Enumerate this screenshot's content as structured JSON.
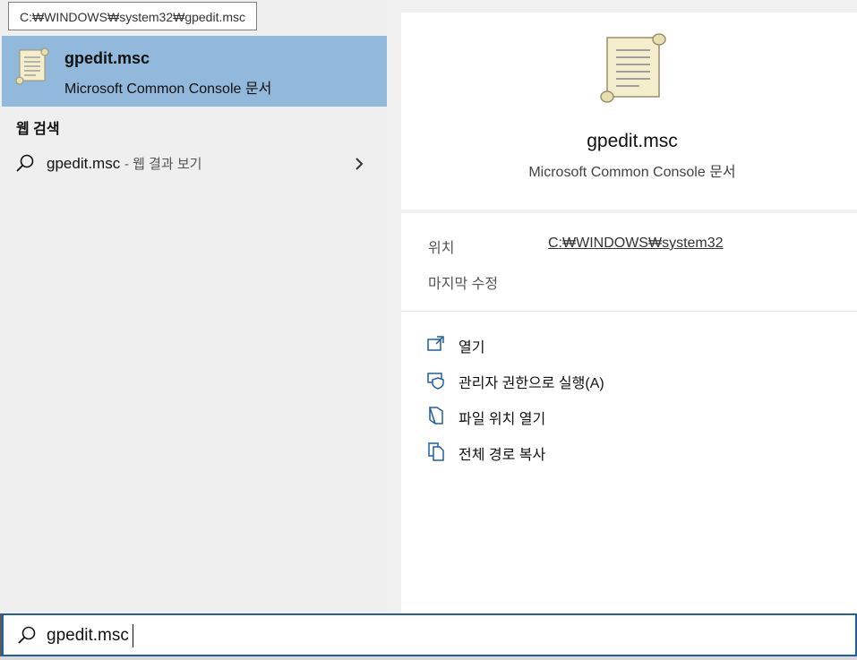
{
  "tooltip": {
    "text": "C:₩WINDOWS₩system32₩gpedit.msc"
  },
  "best_match": {
    "title": "gpedit.msc",
    "subtitle": "Microsoft Common Console 문서",
    "icon": "scroll-document-icon"
  },
  "web_search": {
    "header": "웹 검색",
    "query": "gpedit.msc",
    "suffix": "- 웹 결과 보기",
    "icon": "search-icon",
    "chevron_icon": "chevron-right-icon"
  },
  "details": {
    "icon": "scroll-document-icon",
    "title": "gpedit.msc",
    "subtitle": "Microsoft Common Console 문서",
    "location_label": "위치",
    "location_value": "C:₩WINDOWS₩system32",
    "modified_label": "마지막 수정",
    "actions": [
      {
        "label": "열기",
        "icon": "open-external-icon"
      },
      {
        "label": "관리자 권한으로 실행(A)",
        "icon": "admin-shield-icon"
      },
      {
        "label": "파일 위치 열기",
        "icon": "file-location-icon"
      },
      {
        "label": "전체 경로 복사",
        "icon": "copy-path-icon"
      }
    ]
  },
  "search_box": {
    "value": "gpedit.msc",
    "icon": "search-icon"
  },
  "colors": {
    "selection": "#92b9db",
    "accent": "#1f5fa3",
    "pane_bg": "#efefef"
  }
}
